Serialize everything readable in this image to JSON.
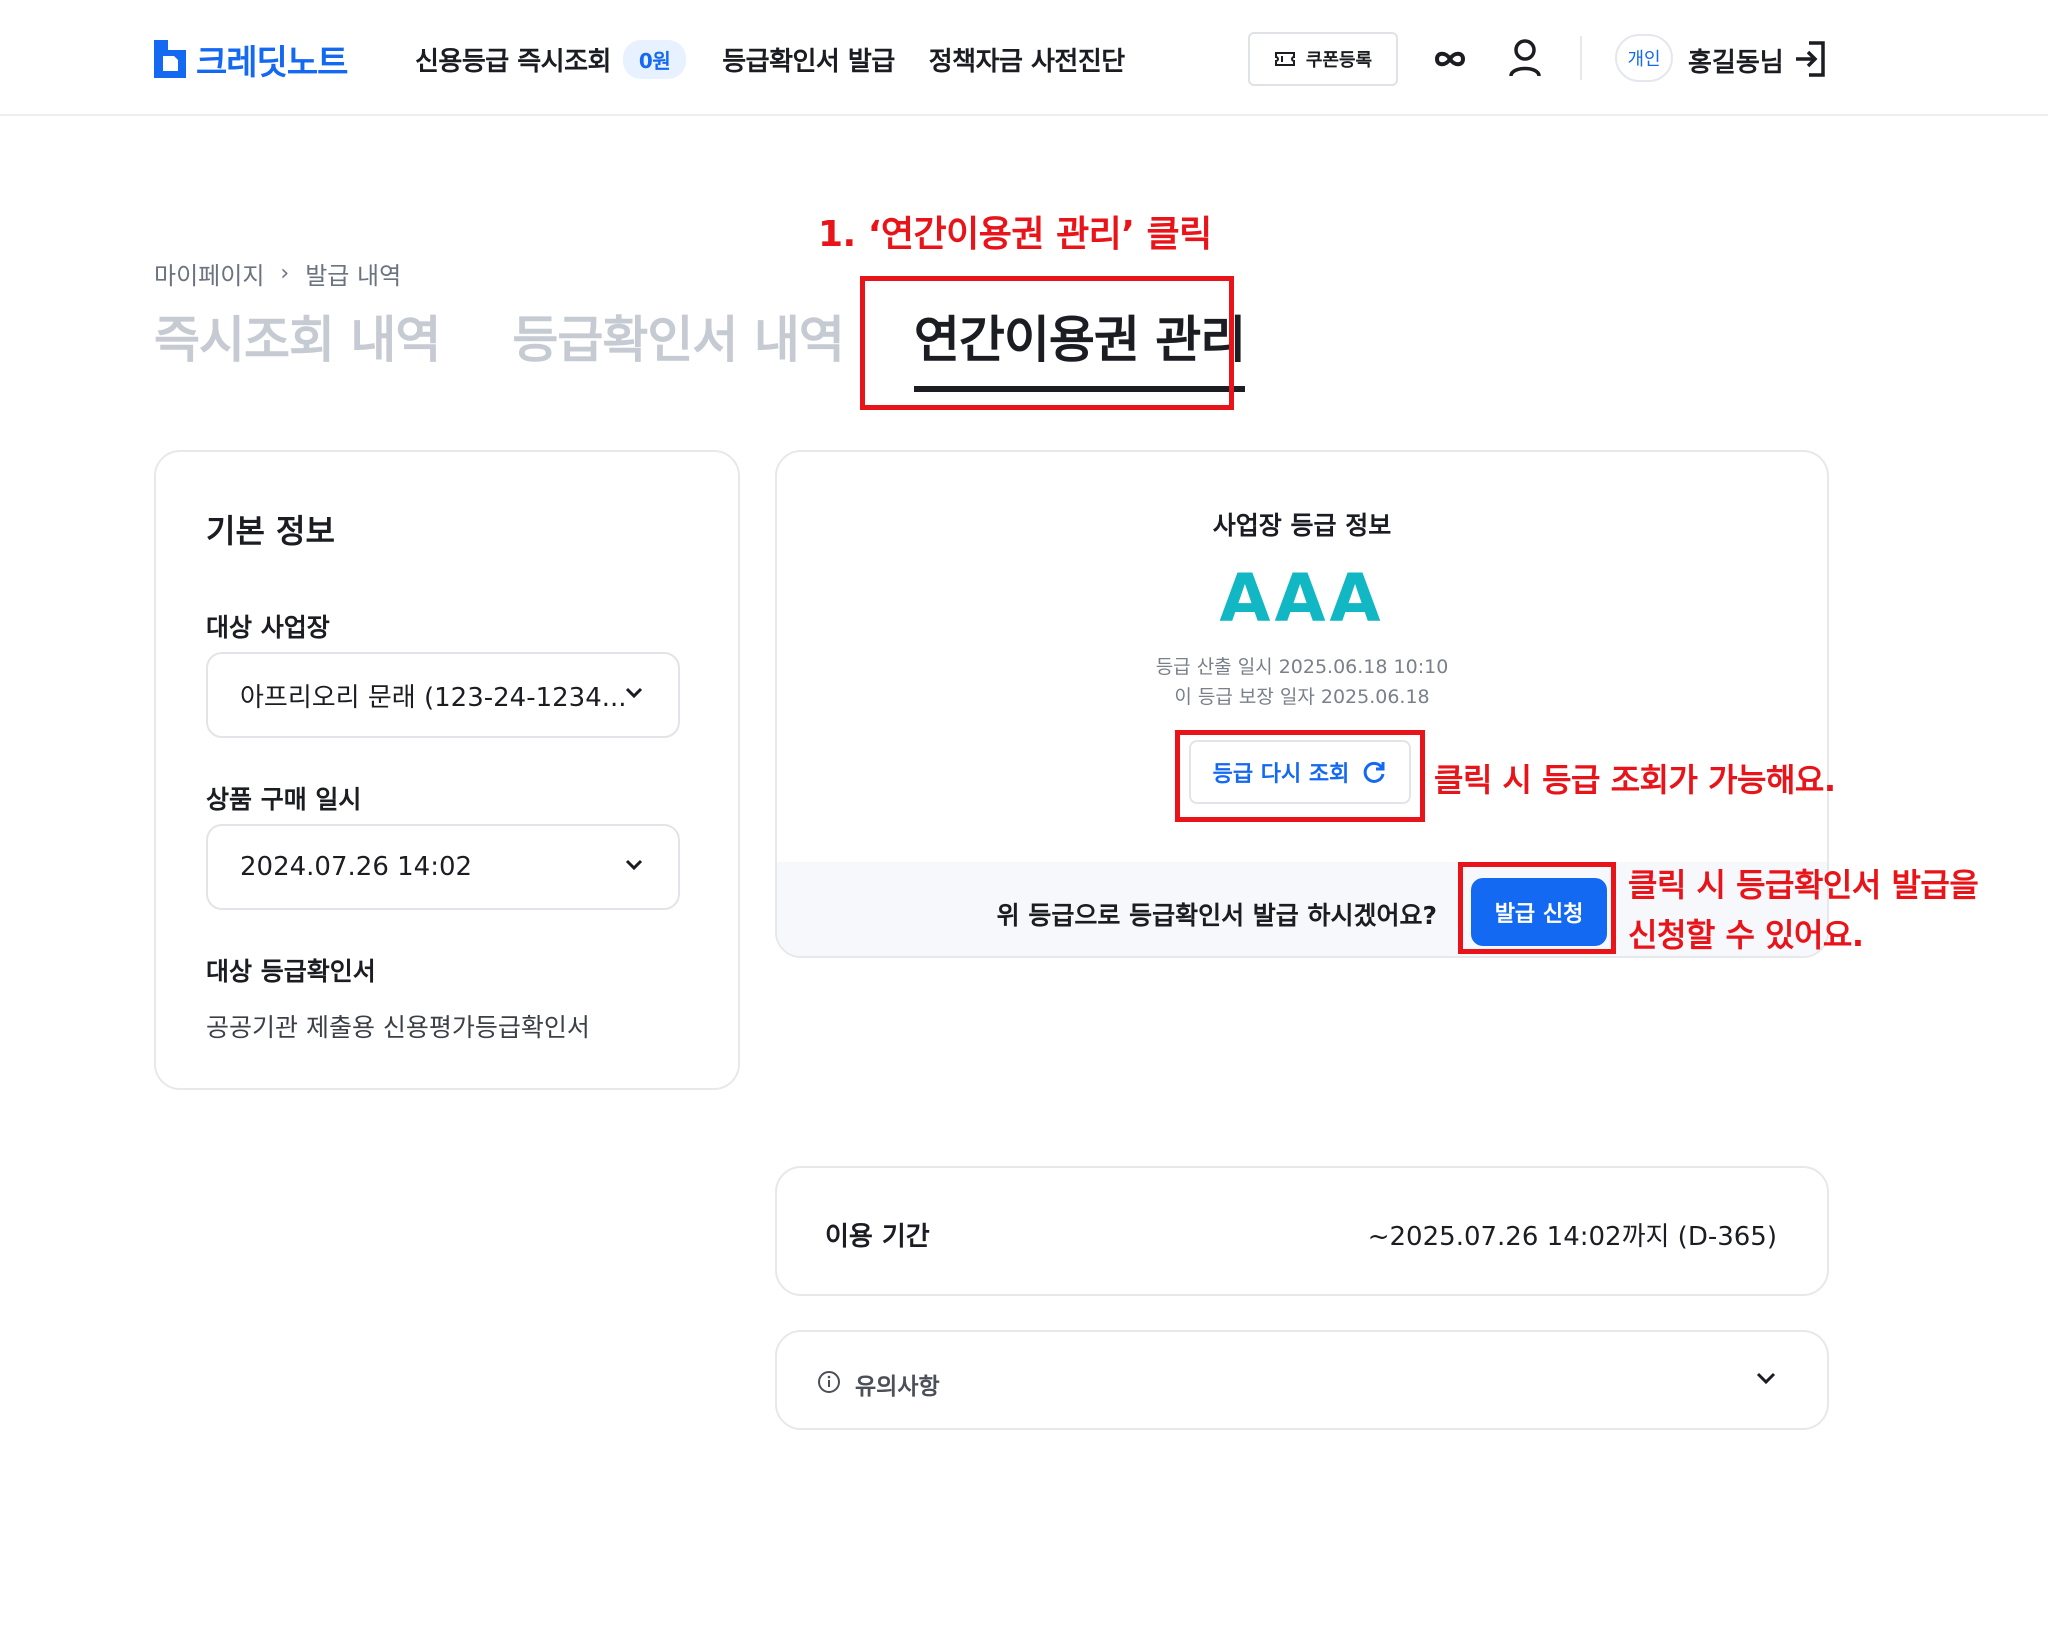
{
  "header": {
    "logo_text": "크레딧노트",
    "nav": {
      "instant_check": "신용등급 즉시조회",
      "instant_badge": "0원",
      "certificate": "등급확인서 발급",
      "policy_fund": "정책자금 사전진단"
    },
    "coupon_label": "쿠폰등록",
    "account_type": "개인",
    "username": "홍길동님"
  },
  "annotations": {
    "step1": "1. ‘연간이용권 관리’ 클릭",
    "reload_hint": "클릭 시 등급 조회가 가능해요.",
    "issue_hint_line1": "클릭 시 등급확인서 발급을",
    "issue_hint_line2": "신청할 수 있어요."
  },
  "breadcrumb": {
    "root": "마이페이지",
    "current": "발급 내역"
  },
  "tabs": [
    {
      "label": "즉시조회 내역",
      "active": false
    },
    {
      "label": "등급확인서 내역",
      "active": false
    },
    {
      "label": "연간이용권 관리",
      "active": true
    }
  ],
  "basic_info": {
    "title": "기본 정보",
    "business_label": "대상 사업장",
    "business_value": "아프리오리 문래 (123-24-1234...",
    "purchase_label": "상품 구매 일시",
    "purchase_value": "2024.07.26 14:02",
    "certificate_label": "대상 등급확인서",
    "certificate_value": "공공기관 제출용 신용평가등급확인서"
  },
  "grade": {
    "title": "사업장 등급 정보",
    "value": "AAA",
    "calculated_at": "등급 산출 일시 2025.06.18 10:10",
    "guaranteed_at": "이 등급 보장 일자 2025.06.18",
    "reload_label": "등급 다시 조회",
    "issue_question": "위 등급으로 등급확인서 발급 하시겠어요?",
    "issue_button": "발급 신청"
  },
  "period": {
    "label": "이용 기간",
    "value": "~2025.07.26 14:02까지 (D-365)"
  },
  "notice": {
    "label": "유의사항"
  },
  "colors": {
    "brand": "#1469f2",
    "grade": "#12b7c4",
    "annotation": "#e8141a"
  }
}
